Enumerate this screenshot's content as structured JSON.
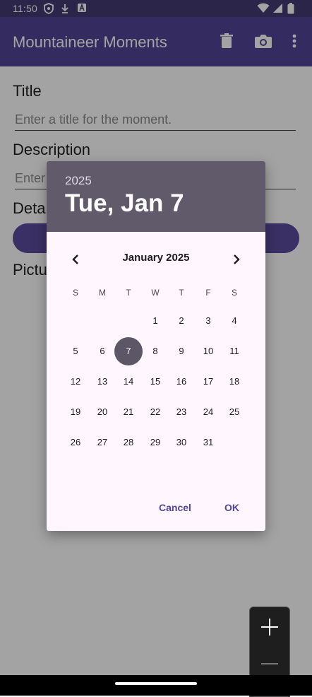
{
  "status_bar": {
    "time": "11:50",
    "icons": [
      "shield-icon",
      "download-icon",
      "notification-icon",
      "wifi-icon",
      "signal-icon",
      "battery-icon"
    ]
  },
  "app_bar": {
    "title": "Mountaineer Moments",
    "actions": [
      "delete-icon",
      "camera-icon",
      "more-vert-icon"
    ]
  },
  "form": {
    "title_label": "Title",
    "title_placeholder": "Enter a title for the moment.",
    "description_label": "Description",
    "description_placeholder": "Enter",
    "date_label": "Deta",
    "picture_label": "Pictu"
  },
  "date_picker": {
    "year": "2025",
    "selected_date_text": "Tue, Jan 7",
    "month_label": "January 2025",
    "weekdays": [
      "S",
      "M",
      "T",
      "W",
      "T",
      "F",
      "S"
    ],
    "first_weekday_index": 3,
    "days_in_month": 31,
    "selected_day": 7,
    "cancel_label": "Cancel",
    "ok_label": "OK"
  },
  "colors": {
    "app_bar": "#524597",
    "status_bar": "#443c73",
    "dialog_header": "#615a6b",
    "selected_day": "#5c5666",
    "accent": "#524597"
  },
  "zoom_controls": [
    "zoom-in-icon",
    "zoom-out-icon"
  ]
}
